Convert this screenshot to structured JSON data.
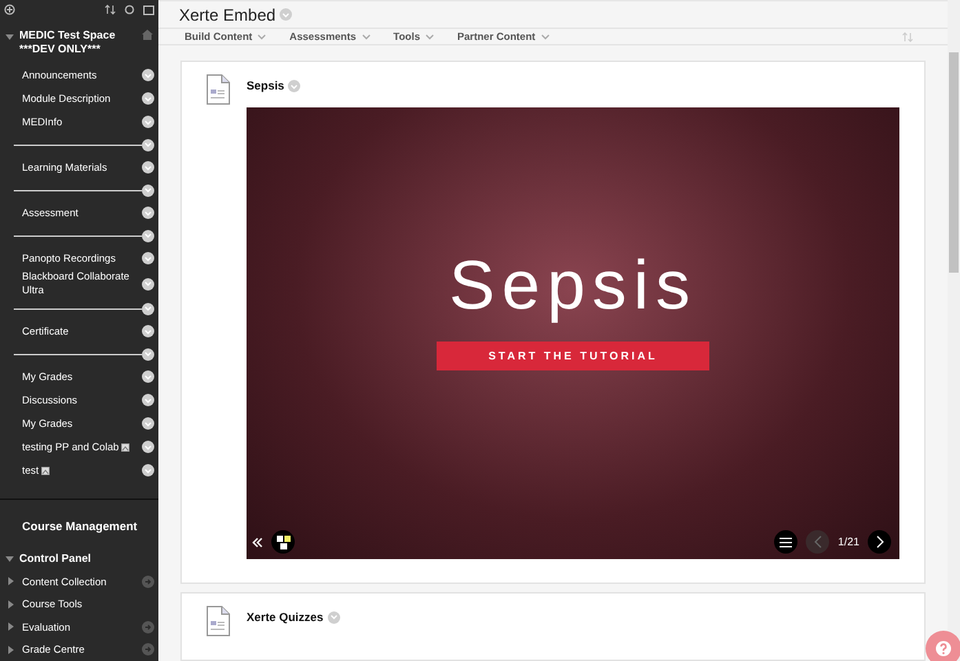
{
  "sidebar": {
    "course_title": "MEDIC Test Space ***DEV ONLY***",
    "expanded": true,
    "items": [
      {
        "kind": "link",
        "label": "Announcements",
        "image_icon": false
      },
      {
        "kind": "link",
        "label": "Module Description",
        "image_icon": false
      },
      {
        "kind": "link",
        "label": "MEDInfo",
        "image_icon": false
      },
      {
        "kind": "divider"
      },
      {
        "kind": "link",
        "label": "Learning Materials",
        "image_icon": false
      },
      {
        "kind": "divider"
      },
      {
        "kind": "link",
        "label": "Assessment",
        "image_icon": false
      },
      {
        "kind": "divider"
      },
      {
        "kind": "link",
        "label": "Panopto Recordings",
        "image_icon": false
      },
      {
        "kind": "link",
        "label": "Blackboard Collaborate Ultra",
        "image_icon": false
      },
      {
        "kind": "divider"
      },
      {
        "kind": "link",
        "label": "Certificate",
        "image_icon": false
      },
      {
        "kind": "divider"
      },
      {
        "kind": "link",
        "label": "My Grades",
        "image_icon": false
      },
      {
        "kind": "link",
        "label": "Discussions",
        "image_icon": false
      },
      {
        "kind": "link",
        "label": "My Grades",
        "image_icon": false
      },
      {
        "kind": "link",
        "label": "testing PP and Colab",
        "image_icon": true
      },
      {
        "kind": "link",
        "label": "test",
        "image_icon": true
      }
    ],
    "management": {
      "title": "Course Management",
      "panel": "Control Panel",
      "panel_expanded": true,
      "items": [
        {
          "label": "Content Collection",
          "expanded": false,
          "has_link": true
        },
        {
          "label": "Course Tools",
          "expanded": false,
          "has_link": false
        },
        {
          "label": "Evaluation",
          "expanded": false,
          "has_link": true
        },
        {
          "label": "Grade Centre",
          "expanded": false,
          "has_link": true
        }
      ]
    }
  },
  "page": {
    "title": "Xerte Embed",
    "toolbar": [
      "Build Content",
      "Assessments",
      "Tools",
      "Partner Content"
    ],
    "items": [
      {
        "title": "Sepsis",
        "embed": {
          "heading": "Sepsis",
          "button": "START THE TUTORIAL",
          "page_counter": "1/21"
        }
      },
      {
        "title": "Xerte Quizzes"
      }
    ]
  }
}
